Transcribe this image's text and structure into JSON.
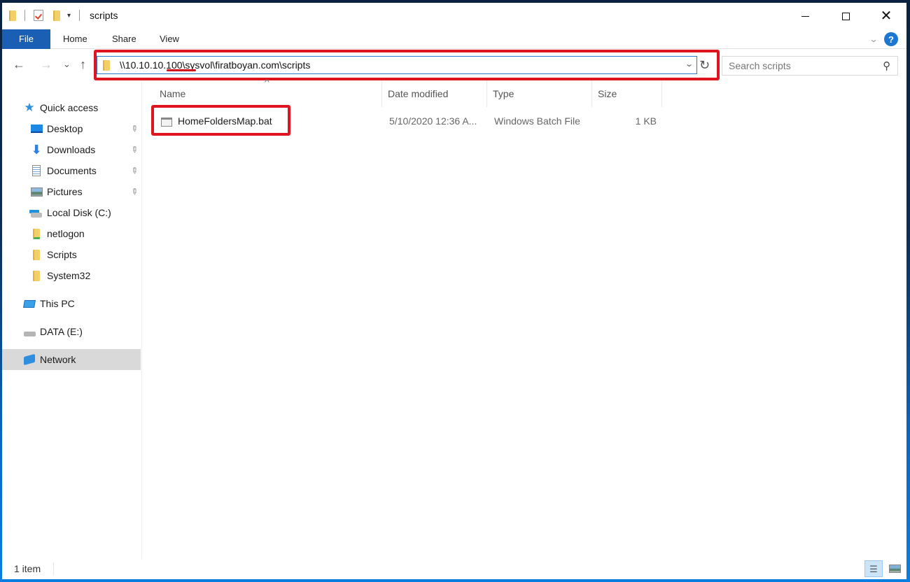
{
  "window": {
    "title": "scripts",
    "controls": {
      "minimize": "—",
      "maximize": "☐",
      "close": "✕"
    }
  },
  "ribbon": {
    "tabs": [
      {
        "label": "File",
        "active": true
      },
      {
        "label": "Home"
      },
      {
        "label": "Share"
      },
      {
        "label": "View"
      }
    ],
    "help_label": "?",
    "accent_color": "#1a5fb4"
  },
  "navigation": {
    "back_icon": "←",
    "forward_icon": "→",
    "recent_icon": "⌄",
    "up_icon": "↑",
    "address": "\\\\10.10.10.100\\sysvol\\firatboyan.com\\scripts",
    "dropdown_icon": "⌄",
    "refresh_icon": "↻",
    "search_placeholder": "Search scripts",
    "search_icon": "⚲",
    "annotation_color": "#e0141e"
  },
  "sidebar": {
    "items": [
      {
        "label": "Quick access",
        "icon": "star-icon",
        "level": 0
      },
      {
        "label": "Desktop",
        "icon": "desktop-icon",
        "level": 1,
        "pinned": true
      },
      {
        "label": "Downloads",
        "icon": "download-icon",
        "level": 1,
        "pinned": true
      },
      {
        "label": "Documents",
        "icon": "document-icon",
        "level": 1,
        "pinned": true
      },
      {
        "label": "Pictures",
        "icon": "pictures-icon",
        "level": 1,
        "pinned": true
      },
      {
        "label": "Local Disk (C:)",
        "icon": "drive-c-icon",
        "level": 1
      },
      {
        "label": "netlogon",
        "icon": "network-folder-icon",
        "level": 1
      },
      {
        "label": "Scripts",
        "icon": "folder-icon",
        "level": 1
      },
      {
        "label": "System32",
        "icon": "folder-icon",
        "level": 1
      },
      {
        "label": "This PC",
        "icon": "computer-icon",
        "level": 0
      },
      {
        "label": "DATA (E:)",
        "icon": "drive-icon",
        "level": 0
      },
      {
        "label": "Network",
        "icon": "network-icon",
        "level": 0,
        "selected": true
      }
    ],
    "pin_icon": "📌"
  },
  "file_list": {
    "columns": [
      "Name",
      "Date modified",
      "Type",
      "Size"
    ],
    "sort_indicator": "^",
    "rows": [
      {
        "name": "HomeFoldersMap.bat",
        "date_modified": "5/10/2020 12:36 A...",
        "type": "Windows Batch File",
        "size": "1 KB",
        "icon": "batch-file-icon"
      }
    ]
  },
  "status": {
    "item_count": "1 item",
    "views": [
      {
        "name": "details-view",
        "active": true
      },
      {
        "name": "large-icons-view",
        "active": false
      }
    ]
  }
}
